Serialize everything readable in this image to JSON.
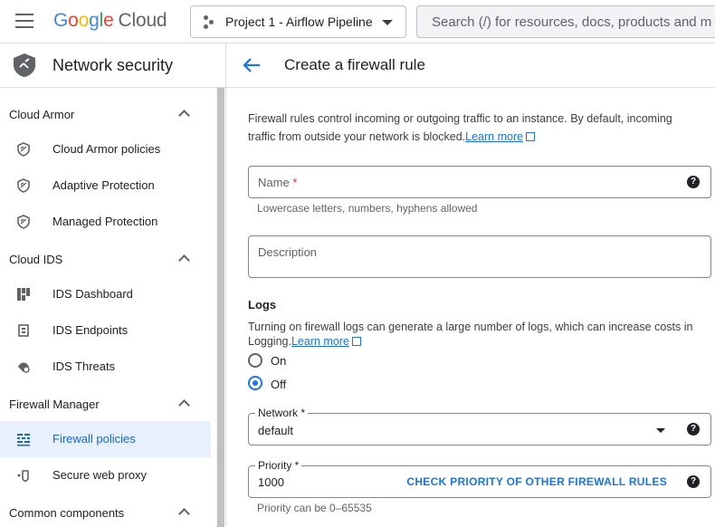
{
  "topbar": {
    "logo_google": "Google",
    "logo_cloud": "Cloud",
    "project_name": "Project 1 - Airflow Pipeline",
    "search_placeholder": "Search (/) for resources, docs, products and m"
  },
  "sidebar": {
    "title": "Network security",
    "groups": [
      {
        "label": "Cloud Armor",
        "items": [
          {
            "label": "Cloud Armor policies",
            "icon": "shield-icon"
          },
          {
            "label": "Adaptive Protection",
            "icon": "shield-icon"
          },
          {
            "label": "Managed Protection",
            "icon": "shield-icon"
          }
        ]
      },
      {
        "label": "Cloud IDS",
        "items": [
          {
            "label": "IDS Dashboard",
            "icon": "dashboard-icon"
          },
          {
            "label": "IDS Endpoints",
            "icon": "endpoint-icon"
          },
          {
            "label": "IDS Threats",
            "icon": "threat-icon"
          }
        ]
      },
      {
        "label": "Firewall Manager",
        "items": [
          {
            "label": "Firewall policies",
            "icon": "firewall-icon",
            "active": true
          },
          {
            "label": "Secure web proxy",
            "icon": "proxy-icon"
          }
        ]
      },
      {
        "label": "Common components",
        "items": []
      }
    ]
  },
  "main": {
    "title": "Create a firewall rule",
    "description": "Firewall rules control incoming or outgoing traffic to an instance. By default, incoming traffic from outside your network is blocked.",
    "learn_more": "Learn more",
    "name_field": {
      "placeholder": "Name",
      "required_mark": "*",
      "hint": "Lowercase letters, numbers, hyphens allowed",
      "value": ""
    },
    "description_field": {
      "placeholder": "Description",
      "value": ""
    },
    "logs": {
      "title": "Logs",
      "description": "Turning on firewall logs can generate a large number of logs, which can increase costs in Logging.",
      "learn_more": "Learn more",
      "options": [
        "On",
        "Off"
      ],
      "selected": "Off"
    },
    "network_field": {
      "label": "Network *",
      "value": "default"
    },
    "priority_field": {
      "label": "Priority *",
      "value": "1000",
      "hint": "Priority can be 0–65535",
      "action": "CHECK PRIORITY OF OTHER FIREWALL RULES"
    }
  },
  "colors": {
    "accent": "#1a73e8",
    "active_bg": "#e8f0fe",
    "required": "#d93025"
  }
}
